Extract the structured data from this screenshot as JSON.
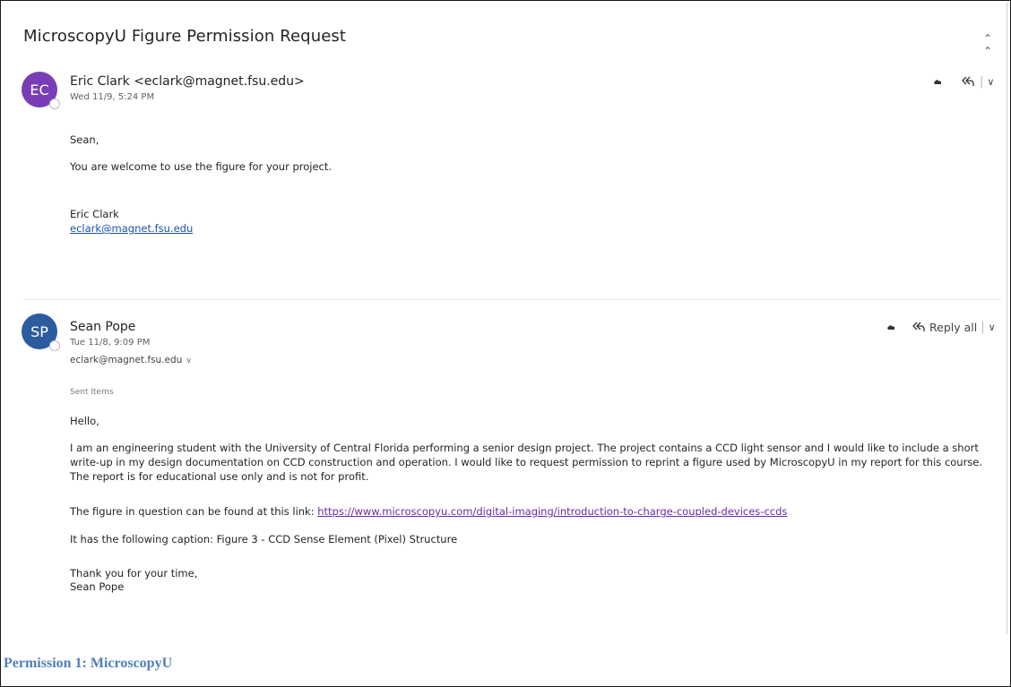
{
  "subject": "MicroscopyU Figure Permission Request",
  "messages": [
    {
      "initials": "EC",
      "sender": "Eric Clark <eclark@magnet.fsu.edu>",
      "date": "Wed 11/9, 5:24 PM",
      "greeting": "Sean,",
      "line1": "You are welcome to use the figure for your project.",
      "sig_name": "Eric Clark",
      "sig_email": "eclark@magnet.fsu.edu"
    },
    {
      "initials": "SP",
      "sender": "Sean Pope",
      "date": "Tue 11/8, 9:09 PM",
      "recipient": "eclark@magnet.fsu.edu",
      "folder": "Sent Items",
      "greeting": "Hello,",
      "para1": "I am an engineering student with the University of Central Florida performing a senior design project. The project contains a CCD light sensor and I would like to include a short write-up in my design documentation on CCD construction and operation. I would like to request permission to reprint a figure used by MicroscopyU in my report for this course. The report is for educational use only and is not for profit.",
      "para2_prefix": "The figure in question can be found at this link: ",
      "para2_link": "https://www.microscopyu.com/digital-imaging/introduction-to-charge-coupled-devices-ccds",
      "para3": "It has the following caption: Figure 3 - CCD Sense Element (Pixel) Structure",
      "closing": "Thank you for your time,",
      "sig_name": "Sean Pope"
    }
  ],
  "actions": {
    "reply_all_label": "Reply all"
  },
  "icons": {
    "collapse": "double-chevron-up-icon",
    "emoji": "hand-emoji-icon",
    "reply": "reply-all-icon",
    "more": "chevron-down-icon"
  },
  "caption": "Permission 1: MicroscopyU",
  "colors": {
    "avatar_ec": "#7a3db5",
    "avatar_sp": "#2c5b9e",
    "caption": "#4f7fb9",
    "link": "#1a53ab"
  }
}
